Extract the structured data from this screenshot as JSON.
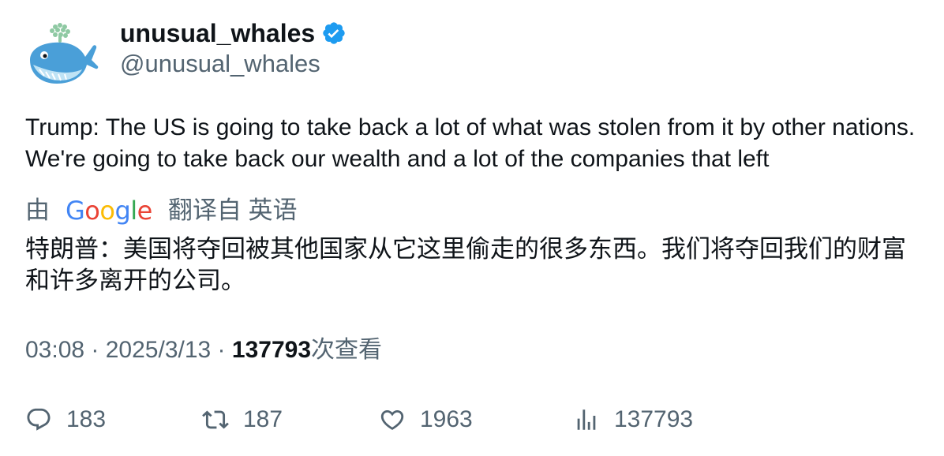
{
  "author": {
    "display_name": "unusual_whales",
    "handle": "@unusual_whales",
    "verified": true,
    "avatar_icon": "whale-logo-icon",
    "verified_color": "#1d9bf0"
  },
  "tweet": {
    "text": "Trump: The US is going to take back a lot of what was stolen from it by other nations. We're going to take back our wealth and a lot of the companies that left"
  },
  "translation": {
    "by_label": "由",
    "provider_parts": [
      "G",
      "o",
      "o",
      "g",
      "l",
      "e"
    ],
    "from_label": "翻译自 英语",
    "text": "特朗普：美国将夺回被其他国家从它这里偷走的很多东西。我们将夺回我们的财富和许多离开的公司。"
  },
  "meta": {
    "time": "03:08",
    "separator": " · ",
    "date": "2025/3/13",
    "views_count": "137793",
    "views_label": "次查看"
  },
  "actions": {
    "replies": "183",
    "retweets": "187",
    "likes": "1963",
    "views": "137793"
  },
  "colors": {
    "text_primary": "#0f1419",
    "text_secondary": "#536471",
    "google_blue": "#4285f4",
    "google_red": "#ea4335",
    "google_yellow": "#fbbc05",
    "google_green": "#34a853"
  }
}
